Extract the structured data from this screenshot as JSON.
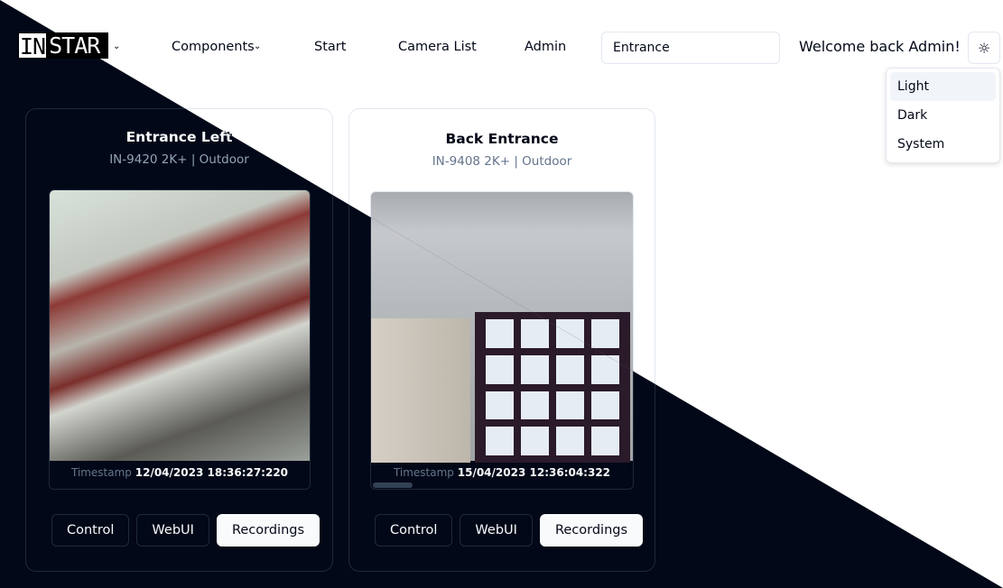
{
  "header": {
    "logo": "INSTAR",
    "nav": [
      "Components",
      "Start",
      "Camera List",
      "Admin"
    ],
    "search_value": "Entrance",
    "welcome": "Welcome back Admin!",
    "theme_icon": "sun-icon"
  },
  "theme_menu": {
    "items": [
      "Light",
      "Dark",
      "System"
    ],
    "highlighted": "Light"
  },
  "cameras": [
    {
      "name": "Entrance Left",
      "model": "IN-9420 2K+ | Outdoor",
      "timestamp_label": "Timestamp",
      "timestamp": "12/04/2023 18:36:27:220"
    },
    {
      "name": "Back Entrance",
      "model": "IN-9408 2K+ | Outdoor",
      "timestamp_label": "Timestamp",
      "timestamp": "15/04/2023 12:36:04:322"
    }
  ],
  "buttons": {
    "control": "Control",
    "webui": "WebUI",
    "recordings": "Recordings"
  },
  "colors": {
    "dark_bg": "#020817",
    "light_bg": "#ffffff"
  }
}
